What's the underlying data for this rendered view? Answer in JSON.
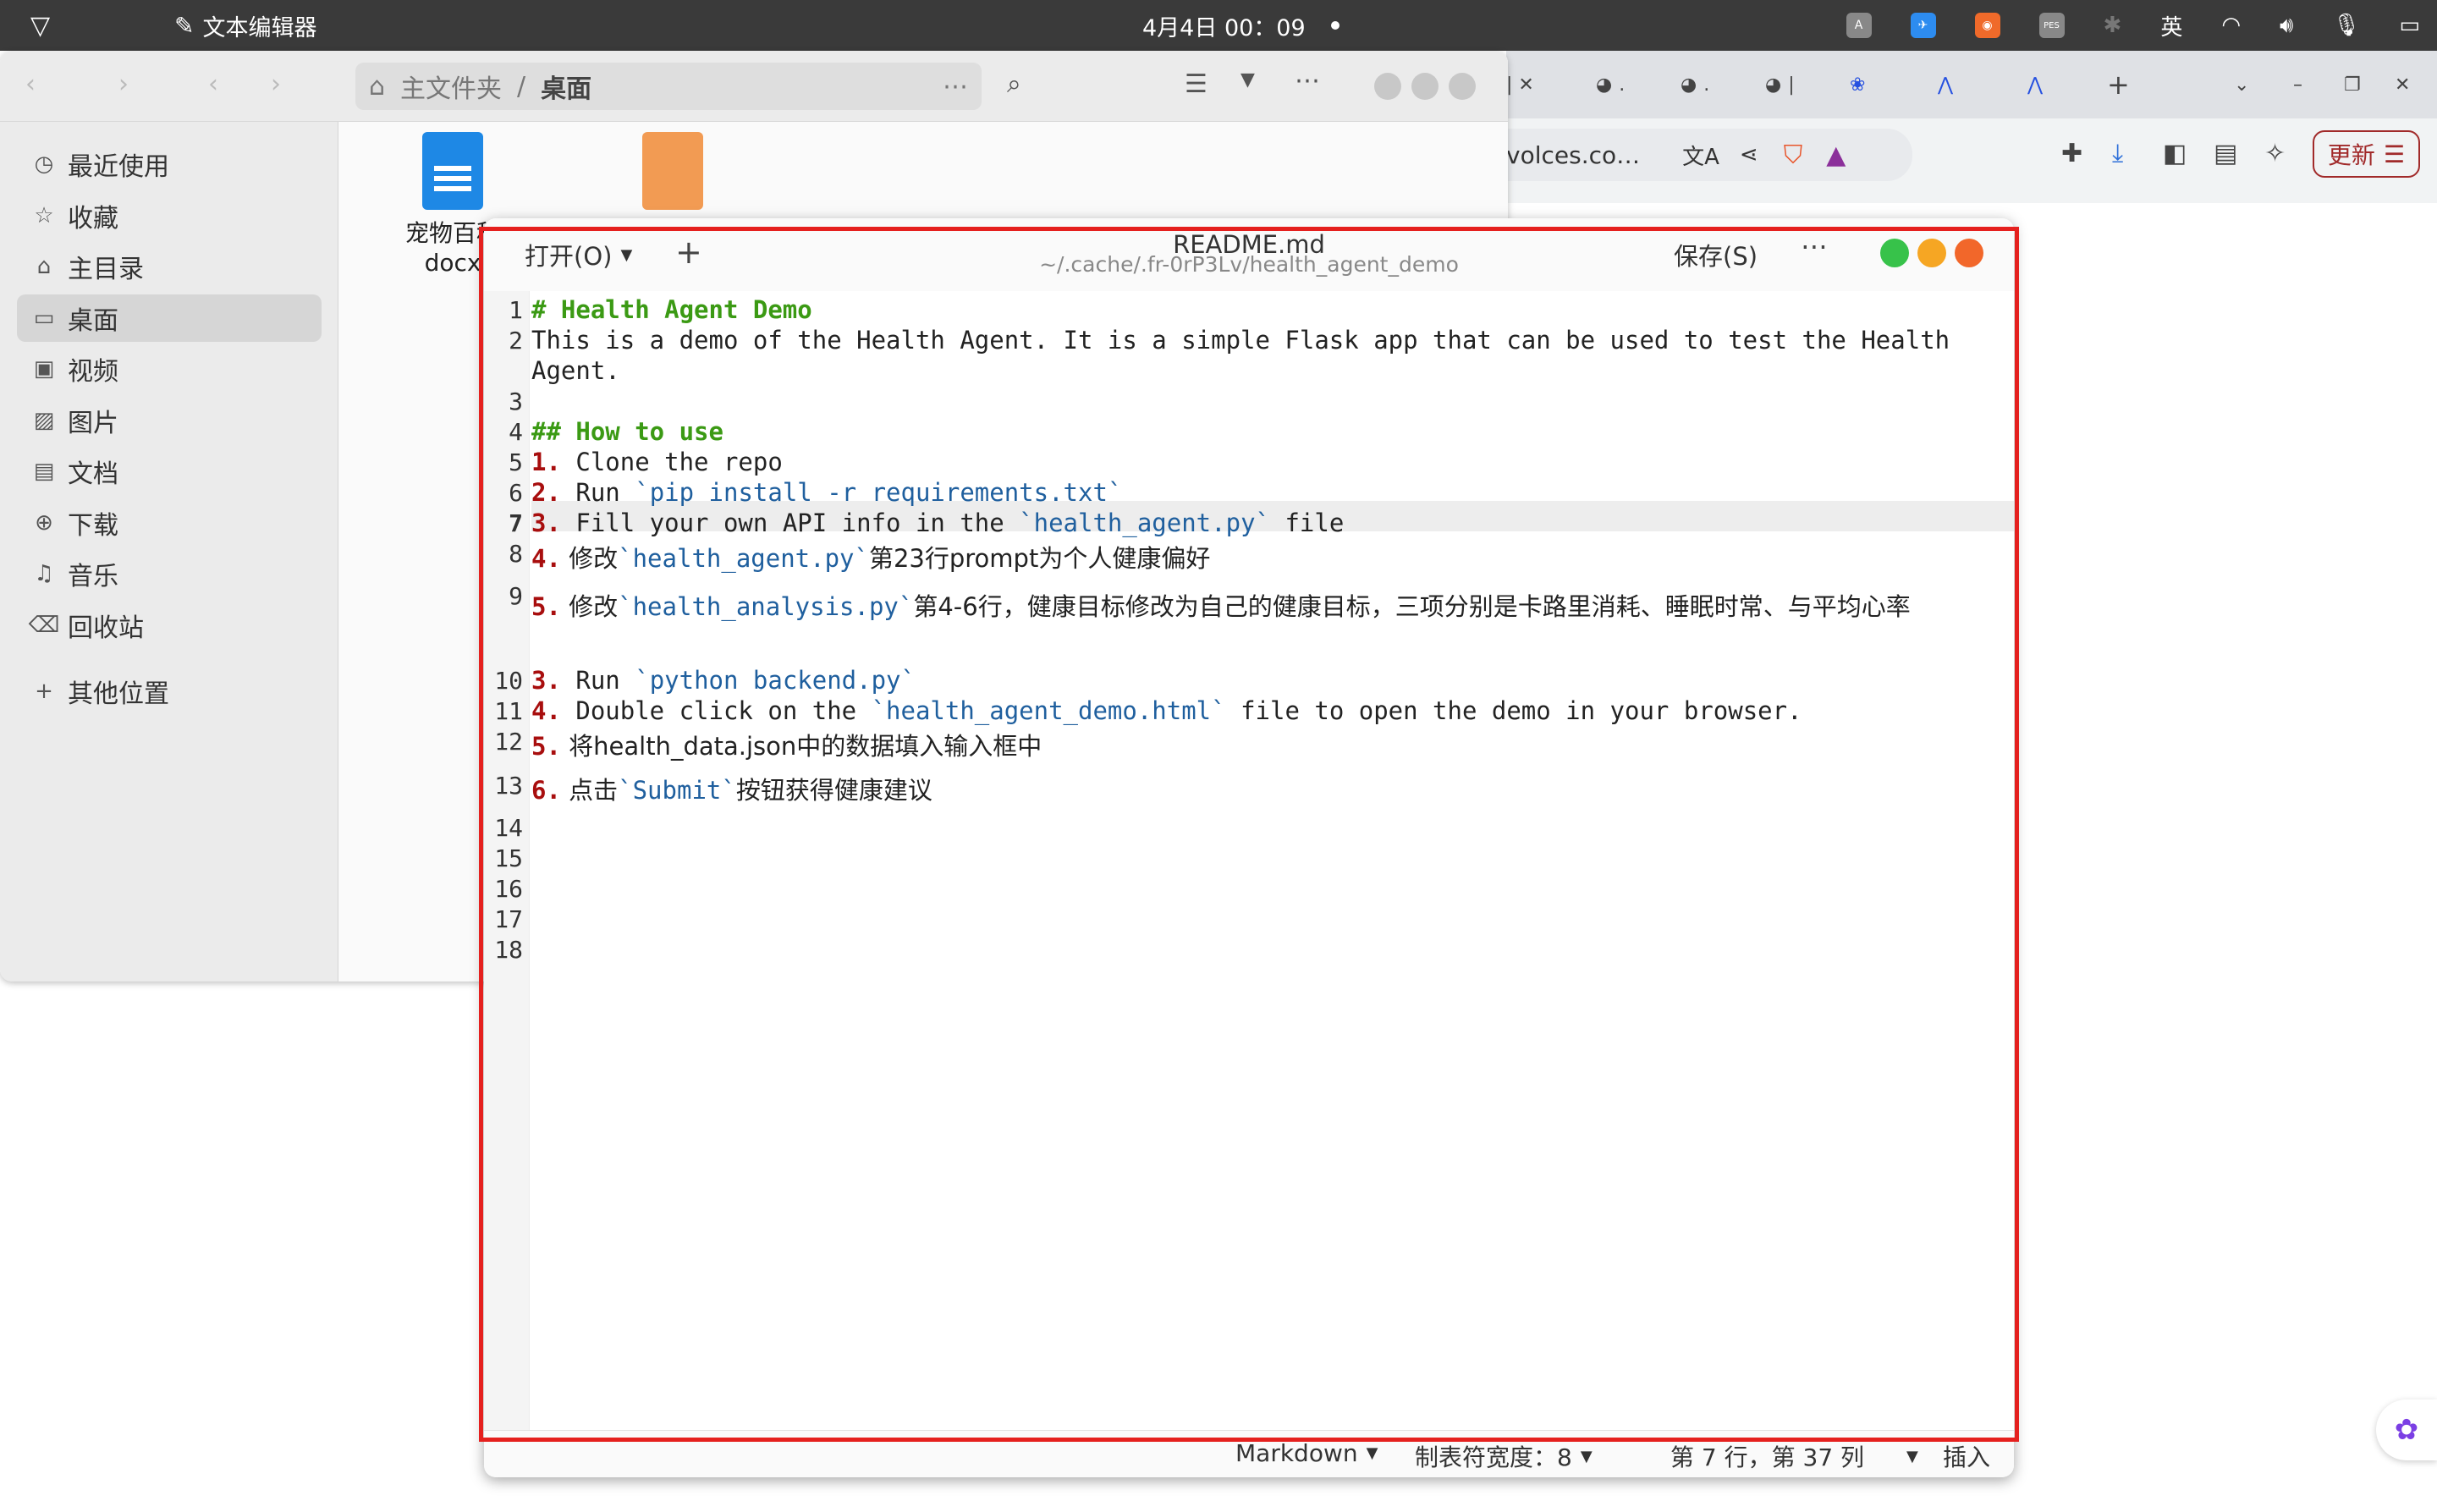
{
  "topbar": {
    "app_name": "文本编辑器",
    "clock": "4月4日  00：09",
    "input_method": "英",
    "tray_pes": "PES"
  },
  "browser": {
    "omnibox_text": "volces.co…",
    "update_label": "更新"
  },
  "files": {
    "path_root": "主文件夹",
    "path_sep": "/",
    "path_current": "桌面",
    "sidebar": [
      {
        "label": "最近使用",
        "icon": "clock-icon"
      },
      {
        "label": "收藏",
        "icon": "star-icon"
      },
      {
        "label": "主目录",
        "icon": "home-icon"
      },
      {
        "label": "桌面",
        "icon": "desktop-icon"
      },
      {
        "label": "视频",
        "icon": "video-icon"
      },
      {
        "label": "图片",
        "icon": "image-icon"
      },
      {
        "label": "文档",
        "icon": "document-icon"
      },
      {
        "label": "下载",
        "icon": "download-icon"
      },
      {
        "label": "音乐",
        "icon": "music-icon"
      },
      {
        "label": "回收站",
        "icon": "trash-icon"
      }
    ],
    "other_places": "其他位置",
    "desktop_file": {
      "line1": "宠物百科",
      "line2": "docx"
    }
  },
  "editor": {
    "open_label": "打开(O)",
    "title": "README.md",
    "subtitle": "~/.cache/.fr-0rP3Lv/health_agent_demo",
    "save_label": "保存(S)",
    "line_numbers": [
      "1",
      "2",
      "3",
      "4",
      "5",
      "6",
      "7",
      "8",
      "9",
      "10",
      "11",
      "12",
      "13",
      "14",
      "15",
      "16",
      "17",
      "18"
    ],
    "lines": {
      "l1": "# Health Agent Demo",
      "l2": "This is a demo of the Health Agent. It is a simple Flask app that can be used to test the Health Agent.",
      "l4": "## How to use",
      "l5_num": "1.",
      "l5_text": " Clone the repo",
      "l6_num": "2.",
      "l6_text": " Run ",
      "l6_code": "`pip install -r requirements.txt`",
      "l7_num": "3.",
      "l7_text": " Fill your own API info in the ",
      "l7_code": "`health_agent.py`",
      "l7_tail": " file",
      "l8_num": "4.",
      "l8_pre": " 修改",
      "l8_code": "`health_agent.py`",
      "l8_tail": "第23行prompt为个人健康偏好",
      "l9_num": "5.",
      "l9_pre": " 修改",
      "l9_code": "`health_analysis.py`",
      "l9_tail": "第4-6行，健康目标修改为自己的健康目标，三项分别是卡路里消耗、睡眠时常、与平均心率",
      "l10_num": "3.",
      "l10_text": " Run ",
      "l10_code": "`python backend.py`",
      "l11_num": "4.",
      "l11_text": " Double click on the ",
      "l11_code": "`health_agent_demo.html`",
      "l11_tail": " file to open the demo in your browser.",
      "l12_num": "5.",
      "l12_text": " 将health_data.json中的数据填入输入框中",
      "l13_num": "6.",
      "l13_pre": " 点击",
      "l13_code": "`Submit`",
      "l13_tail": "按钮获得健康建议"
    },
    "status": {
      "language": "Markdown",
      "tab_width": "制表符宽度：8",
      "position": "第 7 行，第 37 列",
      "mode": "插入"
    }
  },
  "colors": {
    "heading": "#3b9a14",
    "list_number": "#a80e0e",
    "inline_code": "#1f5f9e",
    "highlight_box": "#e5201e",
    "close": "#f2672a",
    "minimize": "#f6a623",
    "maximize": "#37c24a"
  }
}
